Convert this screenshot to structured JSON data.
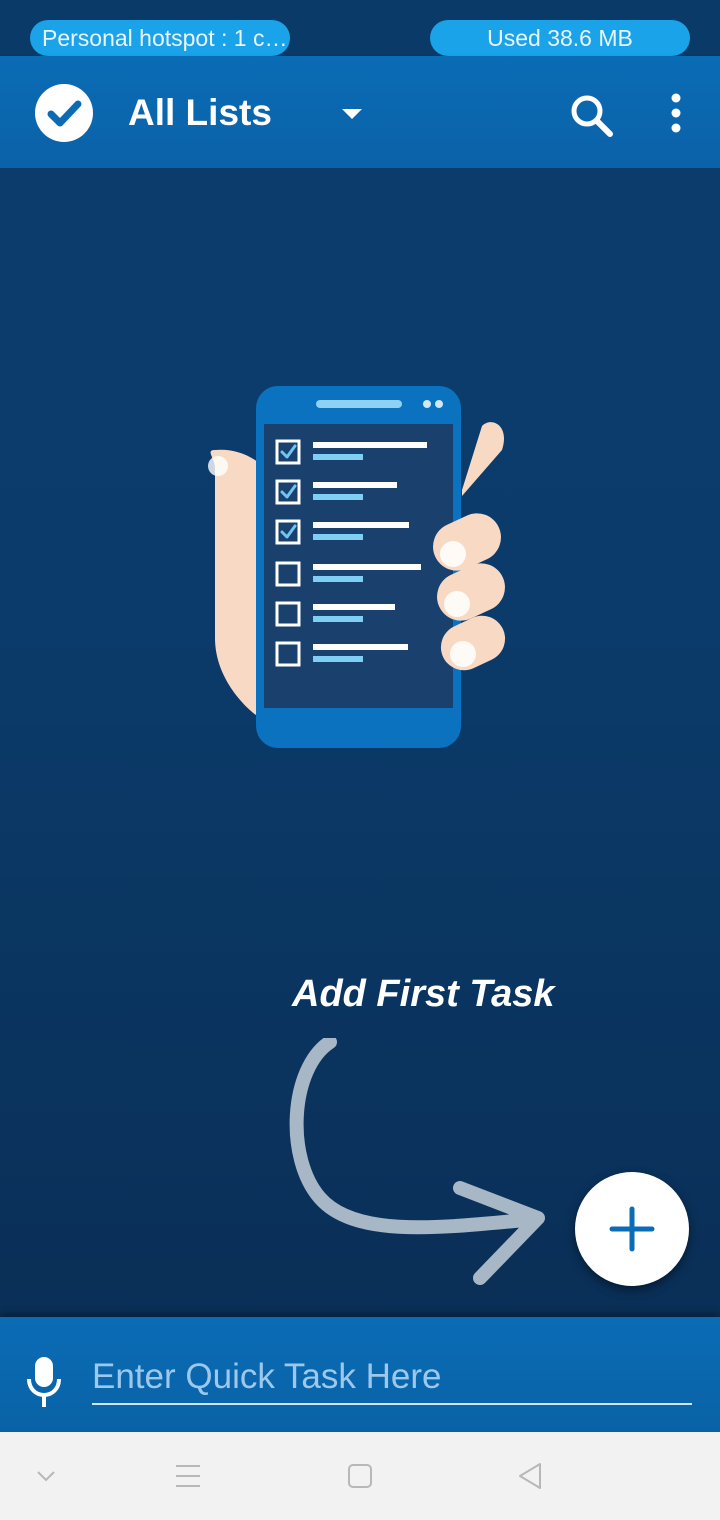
{
  "status": {
    "hotspot_text": "Personal hotspot : 1 c…",
    "data_used_text": "Used  38.6 MB"
  },
  "appbar": {
    "logo_icon": "check-circle-icon",
    "title": "All Lists",
    "dropdown_icon": "caret-down-icon",
    "search_icon": "search-icon",
    "more_icon": "more-vert-icon"
  },
  "empty_state": {
    "illustration": "hand-holding-phone-checklist",
    "hint_text": "Add First Task"
  },
  "fab": {
    "icon": "plus-icon"
  },
  "quick_task": {
    "mic_icon": "microphone-icon",
    "placeholder": "Enter Quick Task Here",
    "value": ""
  },
  "nav": {
    "items": [
      "chevron-down-icon",
      "menu-icon",
      "home-square-icon",
      "back-triangle-icon"
    ]
  },
  "colors": {
    "accent": "#0a6cb5",
    "background": "#0a3a67",
    "pill": "#1aa3e8"
  }
}
